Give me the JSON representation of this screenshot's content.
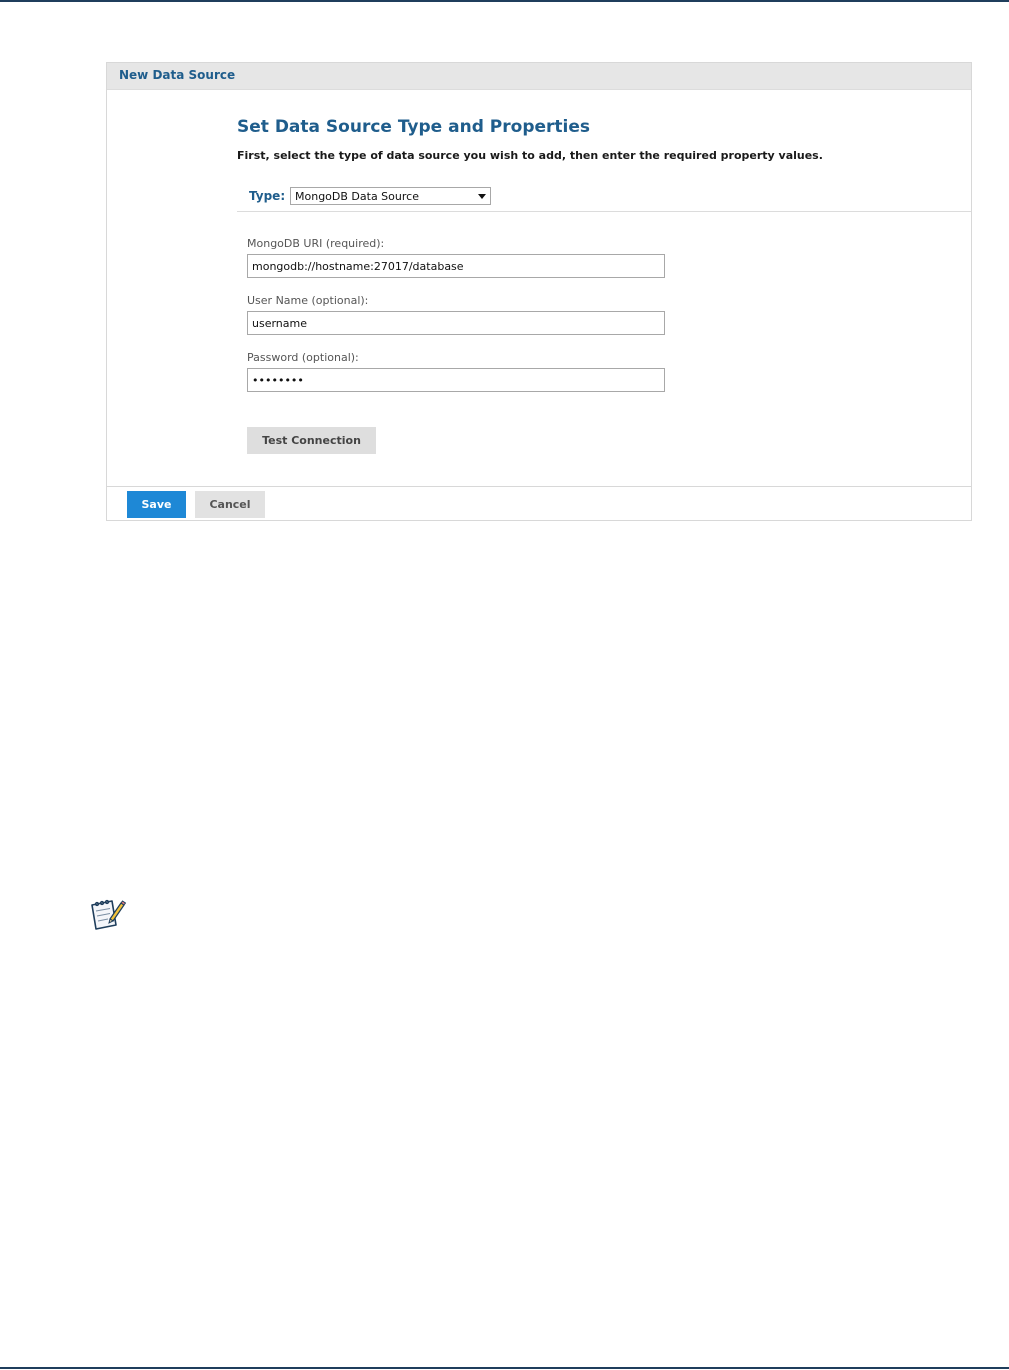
{
  "dialog": {
    "title": "New Data Source"
  },
  "section": {
    "title": "Set Data Source Type and Properties",
    "instructions": "First, select the type of data source you wish to add, then enter the required property values."
  },
  "type_field": {
    "label": "Type:",
    "selected": "MongoDB Data Source"
  },
  "fields": {
    "uri": {
      "label": "MongoDB URI (required):",
      "value": "mongodb://hostname:27017/database"
    },
    "username": {
      "label": "User Name (optional):",
      "value": "username"
    },
    "password": {
      "label": "Password (optional):",
      "value": "password"
    }
  },
  "buttons": {
    "test_connection": "Test Connection",
    "save": "Save",
    "cancel": "Cancel"
  },
  "icons": {
    "note": "note-pencil-icon",
    "dropdown": "chevron-down-icon"
  },
  "colors": {
    "accent": "#1f5d8c",
    "primary_button": "#1e88d6",
    "rule": "#1f3e5c"
  }
}
